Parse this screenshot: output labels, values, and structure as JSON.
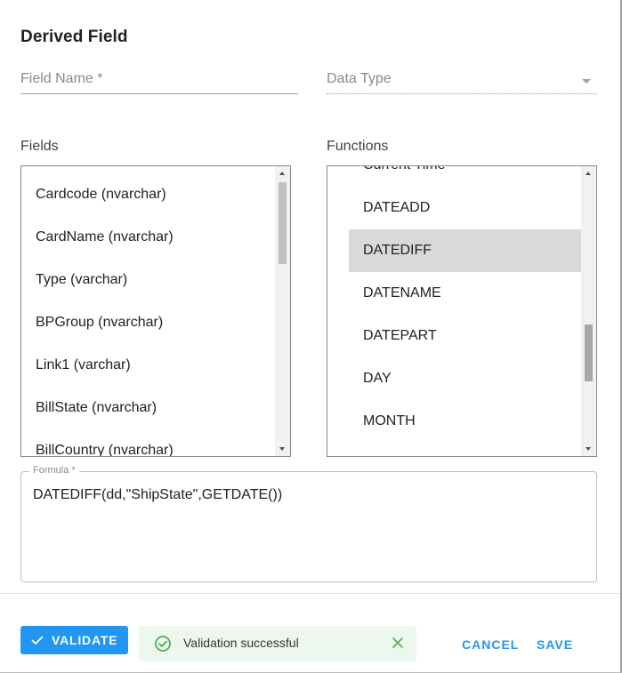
{
  "dialog": {
    "title": "Derived Field"
  },
  "field_name": {
    "placeholder": "Field Name *"
  },
  "data_type": {
    "placeholder": "Data Type"
  },
  "fields": {
    "label": "Fields",
    "items": [
      "Cardcode (nvarchar)",
      "CardName (nvarchar)",
      "Type (varchar)",
      "BPGroup (nvarchar)",
      "Link1 (varchar)",
      "BillState (nvarchar)",
      "BillCountry (nvarchar)"
    ]
  },
  "functions": {
    "label": "Functions",
    "items": [
      "Current Time",
      "DATEADD",
      "DATEDIFF",
      "DATENAME",
      "DATEPART",
      "DAY",
      "MONTH"
    ],
    "selected": "DATEDIFF"
  },
  "formula": {
    "label": "Formula *",
    "value": "DATEDIFF(dd,\"ShipState\",GETDATE())"
  },
  "footer": {
    "validate_label": "VALIDATE",
    "toast_message": "Validation successful",
    "cancel_label": "CANCEL",
    "save_label": "SAVE"
  },
  "colors": {
    "accent": "#2196f3",
    "success": "#4caf50",
    "toast_bg": "#edf7ed",
    "selected_row": "#d9d9d9"
  },
  "icons": {
    "validate": "check-icon",
    "toast": "check-circle-icon",
    "toast_close": "close-icon",
    "data_type": "chevron-down-icon"
  }
}
